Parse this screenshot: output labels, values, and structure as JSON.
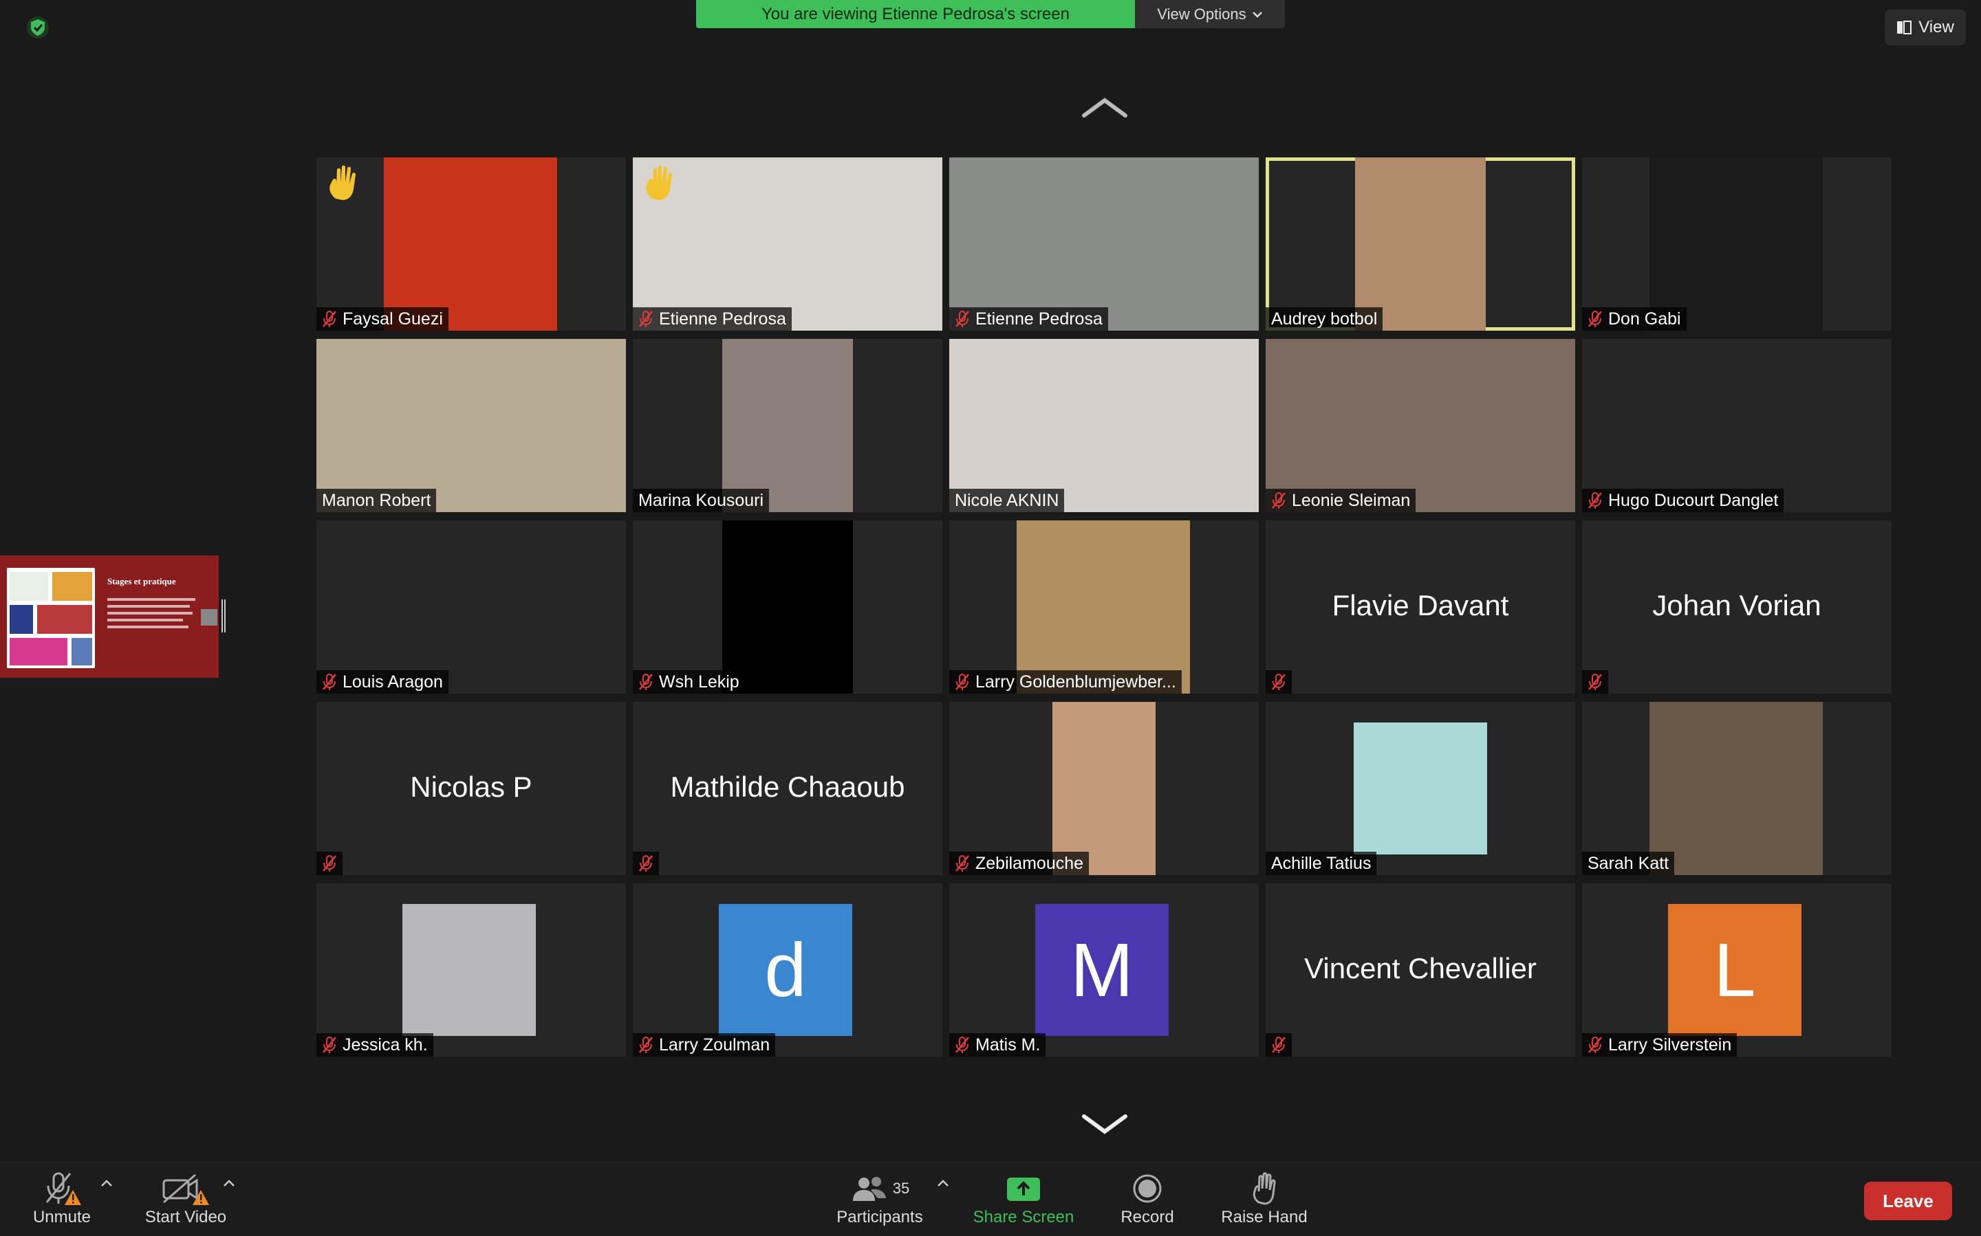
{
  "banner": {
    "text": "You are viewing Etienne Pedrosa's screen",
    "options_label": "View Options"
  },
  "view_button": {
    "label": "View"
  },
  "share_preview": {
    "title": "Stages et pratique"
  },
  "participants": [
    {
      "name": "Faysal Guezi",
      "muted": true,
      "hand": true,
      "type": "photo",
      "color": "#c8331c"
    },
    {
      "name": "Etienne Pedrosa",
      "muted": true,
      "hand": true,
      "type": "photo",
      "color": "#d8d4d0"
    },
    {
      "name": "Etienne Pedrosa",
      "muted": true,
      "type": "photo",
      "color": "#8a8c8a"
    },
    {
      "name": "Audrey botbol",
      "muted": false,
      "type": "photo",
      "color": "#b08c6c"
    },
    {
      "name": "Don Gabi",
      "muted": true,
      "type": "photo",
      "color": "#1b1b1b"
    },
    {
      "name": "Manon Robert",
      "muted": false,
      "type": "photo",
      "color": "#b7ab93"
    },
    {
      "name": "Marina Kousouri",
      "muted": false,
      "type": "photo",
      "color": "#8c7e78"
    },
    {
      "name": "Nicole AKNIN",
      "muted": false,
      "type": "photo",
      "color": "#d6d0cc"
    },
    {
      "name": "Leonie Sleiman",
      "muted": true,
      "type": "photo",
      "color": "#7a6a60"
    },
    {
      "name": "Hugo Ducourt Danglet",
      "muted": true,
      "type": "blank"
    },
    {
      "name": "Louis Aragon",
      "muted": true,
      "type": "blank"
    },
    {
      "name": "Wsh Lekip",
      "muted": true,
      "type": "photo",
      "color": "#000000"
    },
    {
      "name": "Larry Goldenblumjewber...",
      "muted": true,
      "type": "photo",
      "color": "#b09060"
    },
    {
      "name": "Flavie Davant",
      "muted": true,
      "type": "text"
    },
    {
      "name": "Johan Vorian",
      "muted": true,
      "type": "text"
    },
    {
      "name": "Nicolas P",
      "muted": true,
      "type": "text"
    },
    {
      "name": "Mathilde Chaaoub",
      "muted": true,
      "type": "text"
    },
    {
      "name": "Zebilamouche",
      "muted": true,
      "type": "photo",
      "color": "#c59a7a"
    },
    {
      "name": "Achille Tatius",
      "muted": false,
      "type": "photo",
      "color": "#a9dad8"
    },
    {
      "name": "Sarah Katt",
      "muted": false,
      "type": "photo",
      "color": "#6a5848"
    },
    {
      "name": "Jessica kh.",
      "muted": true,
      "type": "photo",
      "color": "#b8b8bc"
    },
    {
      "name": "Larry Zoulman",
      "muted": true,
      "type": "letter",
      "letter": "d",
      "color": "#3a86d0"
    },
    {
      "name": "Matis M.",
      "muted": true,
      "type": "letter",
      "letter": "M",
      "color": "#4b37b0"
    },
    {
      "name": "Vincent Chevallier",
      "muted": true,
      "type": "text"
    },
    {
      "name": "Larry Silverstein",
      "muted": true,
      "type": "letter",
      "letter": "L",
      "color": "#e4732a"
    }
  ],
  "toolbar": {
    "unmute": "Unmute",
    "start_video": "Start Video",
    "participants": "Participants",
    "participants_count": "35",
    "share_screen": "Share Screen",
    "record": "Record",
    "raise_hand": "Raise Hand",
    "leave": "Leave"
  },
  "colors": {
    "accent_green": "#3fbf59",
    "leave_red": "#c9302c",
    "active_speaker": "#dfe38c"
  }
}
